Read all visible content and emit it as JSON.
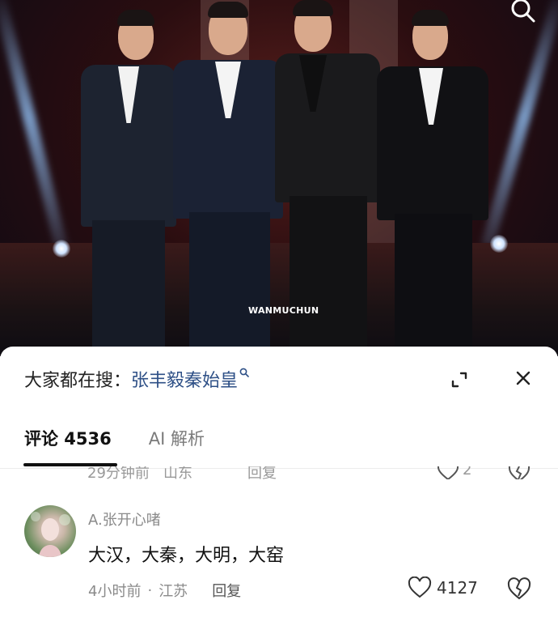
{
  "photo": {
    "watermark": "WANMUCHUN"
  },
  "sheet": {
    "search_prefix": "大家都在搜：",
    "search_query": "张丰毅秦始皇",
    "tabs": [
      {
        "label": "评论 4536",
        "active": true
      },
      {
        "label": "AI 解析",
        "active": false
      }
    ],
    "previous_comment_meta": {
      "time": "29分钟前",
      "location": "山东",
      "reply": "回复",
      "likes": "2"
    },
    "comment": {
      "username": "A.张开心啫",
      "text": "大汉，大秦，大明，大窑",
      "time": "4小时前",
      "dot": "·",
      "location": "江苏",
      "reply": "回复",
      "likes": "4127"
    }
  },
  "icons": {
    "search": "search-icon",
    "expand": "expand-icon",
    "close": "close-icon",
    "like": "heart-icon",
    "dislike": "broken-heart-icon"
  },
  "colors": {
    "link_blue": "#2d4f86",
    "muted_gray": "#8a8a8a",
    "text_dark": "#111111"
  }
}
